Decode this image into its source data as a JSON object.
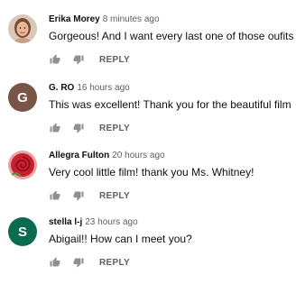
{
  "comments": [
    {
      "author": "Erika Morey",
      "time": "8 minutes ago",
      "text": "Gorgeous! And I want every last one of those oufits...",
      "avatar": {
        "type": "photo",
        "icon": "profile-photo"
      },
      "reply_label": "REPLY"
    },
    {
      "author": "G. RO",
      "time": "16 hours ago",
      "text": "This was excellent! Thank you for the beautiful film",
      "avatar": {
        "type": "letter",
        "letter": "G",
        "color": "#795548"
      },
      "reply_label": "REPLY"
    },
    {
      "author": "Allegra Fulton",
      "time": "20 hours ago",
      "text": "Very cool little film! thank you Ms. Whitney!",
      "avatar": {
        "type": "photo",
        "icon": "rose-photo"
      },
      "reply_label": "REPLY"
    },
    {
      "author": "stella l-j",
      "time": "23 hours ago",
      "text": "Abigail!! How can I meet you?",
      "avatar": {
        "type": "letter",
        "letter": "S",
        "color": "#0b6b50"
      },
      "reply_label": "REPLY"
    }
  ],
  "icons": {
    "like": "thumbs-up-icon",
    "dislike": "thumbs-down-icon"
  },
  "colors": {
    "text": "#0f0f0f",
    "secondary": "#606060",
    "icon": "#909090"
  }
}
